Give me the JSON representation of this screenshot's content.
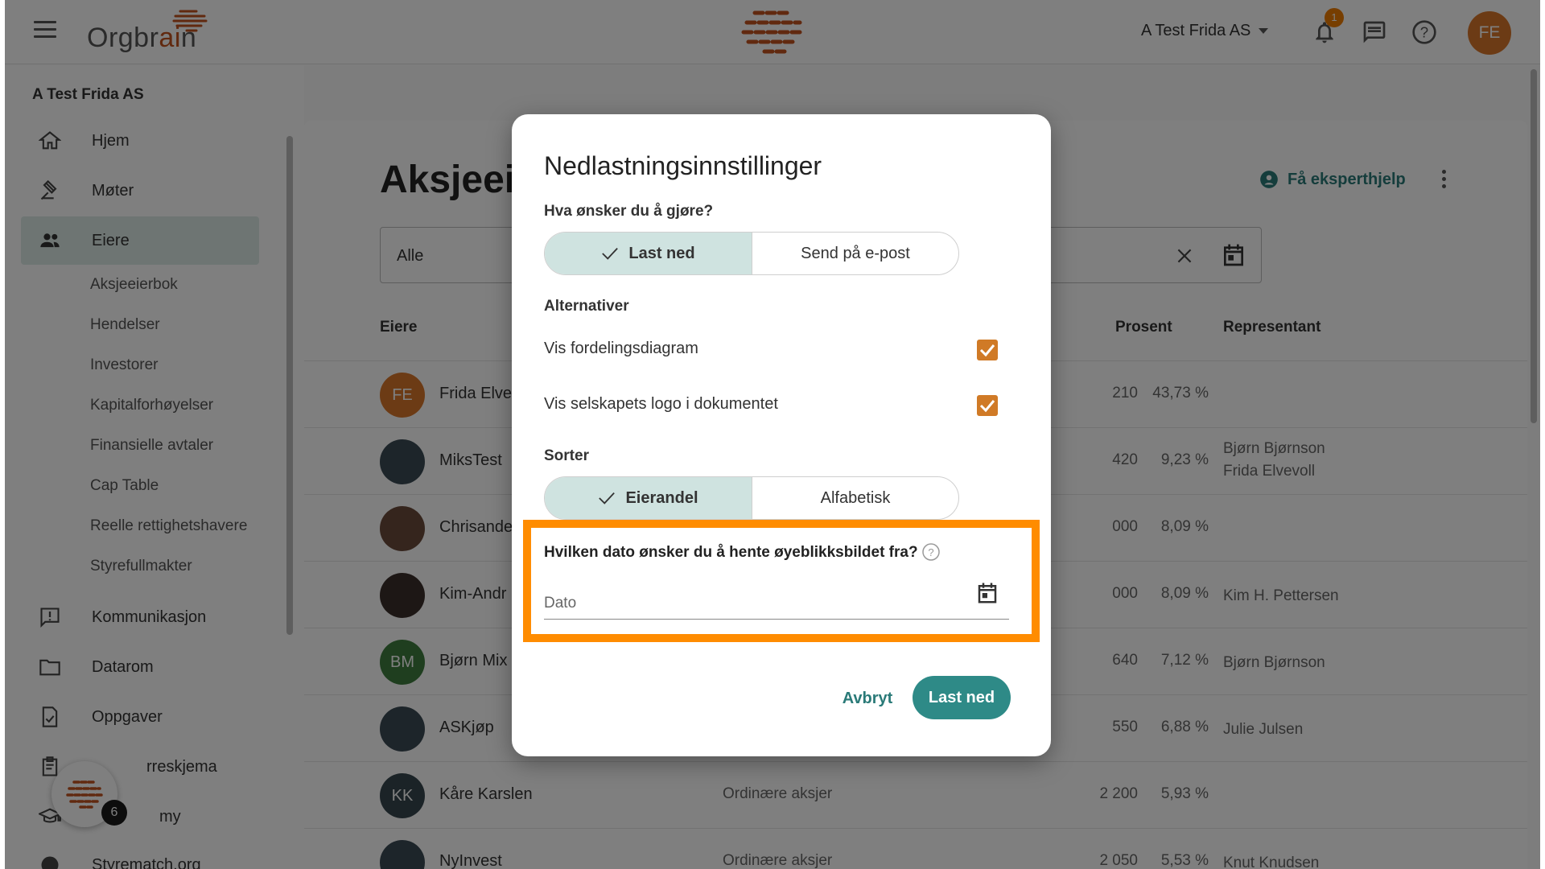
{
  "topbar": {
    "logo_text_main": "Orgbr",
    "logo_text_accent": "ai",
    "logo_text_end": "n",
    "company_selector": "A Test Frida AS",
    "notification_count": "1",
    "user_initials": "FE",
    "brand_color": "#c2521e"
  },
  "sidebar": {
    "company_name": "A Test Frida AS",
    "items": [
      {
        "label": "Hjem",
        "icon": "home-icon"
      },
      {
        "label": "Møter",
        "icon": "gavel-icon"
      },
      {
        "label": "Eiere",
        "icon": "people-icon"
      },
      {
        "label": "Kommunikasjon",
        "icon": "message-alert-icon"
      },
      {
        "label": "Datarom",
        "icon": "folder-icon"
      },
      {
        "label": "Oppgaver",
        "icon": "task-icon"
      },
      {
        "label": "rreskjema",
        "icon": "clipboard-icon"
      },
      {
        "label": "my",
        "icon": "school-icon"
      },
      {
        "label": "Styrematch.org",
        "icon": "globe-icon"
      }
    ],
    "subitems": [
      "Aksjeeierbok",
      "Hendelser",
      "Investorer",
      "Kapitalforhøyelser",
      "Finansielle avtaler",
      "Cap Table",
      "Reelle rettighetshavere",
      "Styrefullmakter"
    ],
    "fab_badge": "6"
  },
  "main": {
    "title": "Aksjeeie",
    "expert_help": "Få eksperthjelp",
    "filter_value": "Alle",
    "columns": {
      "owners": "Eiere",
      "percent": "Prosent",
      "representative": "Representant"
    },
    "rows": [
      {
        "initials": "FE",
        "name": "Frida Elve",
        "type": "",
        "num": "210",
        "pct": "43,73 %",
        "rep": [],
        "avatar_color": "#d9762b"
      },
      {
        "initials": "",
        "name": "MiksTest",
        "type": "",
        "num": "420",
        "pct": "9,23 %",
        "rep": [
          "Bjørn Bjørnson",
          "Frida Elvevoll"
        ],
        "avatar_color": "#3a4a55"
      },
      {
        "initials": "",
        "name": "Chrisande",
        "type": "",
        "num": "000",
        "pct": "8,09 %",
        "rep": [],
        "avatar_color": "#6b4a3a"
      },
      {
        "initials": "",
        "name": "Kim-Andr",
        "type": "",
        "num": "000",
        "pct": "8,09 %",
        "rep": [
          "Kim H. Pettersen"
        ],
        "avatar_color": "#3b2f2a"
      },
      {
        "initials": "BM",
        "name": "Bjørn Mix",
        "type": "",
        "num": "640",
        "pct": "7,12 %",
        "rep": [
          "Bjørn Bjørnson"
        ],
        "avatar_color": "#3e7d3e"
      },
      {
        "initials": "",
        "name": "ASKjøp",
        "type": "",
        "num": "550",
        "pct": "6,88 %",
        "rep": [
          "Julie Julsen"
        ],
        "avatar_color": "#3a4a55"
      },
      {
        "initials": "KK",
        "name": "Kåre Karslen",
        "type": "Ordinære aksjer",
        "num": "2 200",
        "pct": "5,93 %",
        "rep": [],
        "avatar_color": "#37474f"
      },
      {
        "initials": "",
        "name": "NyInvest",
        "type": "Ordinære aksjer",
        "num": "2 050",
        "pct": "5,53 %",
        "rep": [
          "Knut Knudsen"
        ],
        "avatar_color": "#3a4a55"
      }
    ]
  },
  "dialog": {
    "title": "Nedlastningsinnstillinger",
    "action_question": "Hva ønsker du å gjøre?",
    "action_options": [
      "Last ned",
      "Send på e-post"
    ],
    "alternatives_heading": "Alternativer",
    "option_diagram": "Vis fordelingsdiagram",
    "option_logo": "Vis selskapets logo i dokumentet",
    "sort_heading": "Sorter",
    "sort_options": [
      "Eierandel",
      "Alfabetisk"
    ],
    "date_question": "Hvilken dato ønsker du å hente øyeblikksbildet fra?",
    "date_placeholder": "Dato",
    "cancel_label": "Avbryt",
    "download_label": "Last ned",
    "accent_color": "#2e8a87",
    "highlight_color": "#ff8c00"
  }
}
